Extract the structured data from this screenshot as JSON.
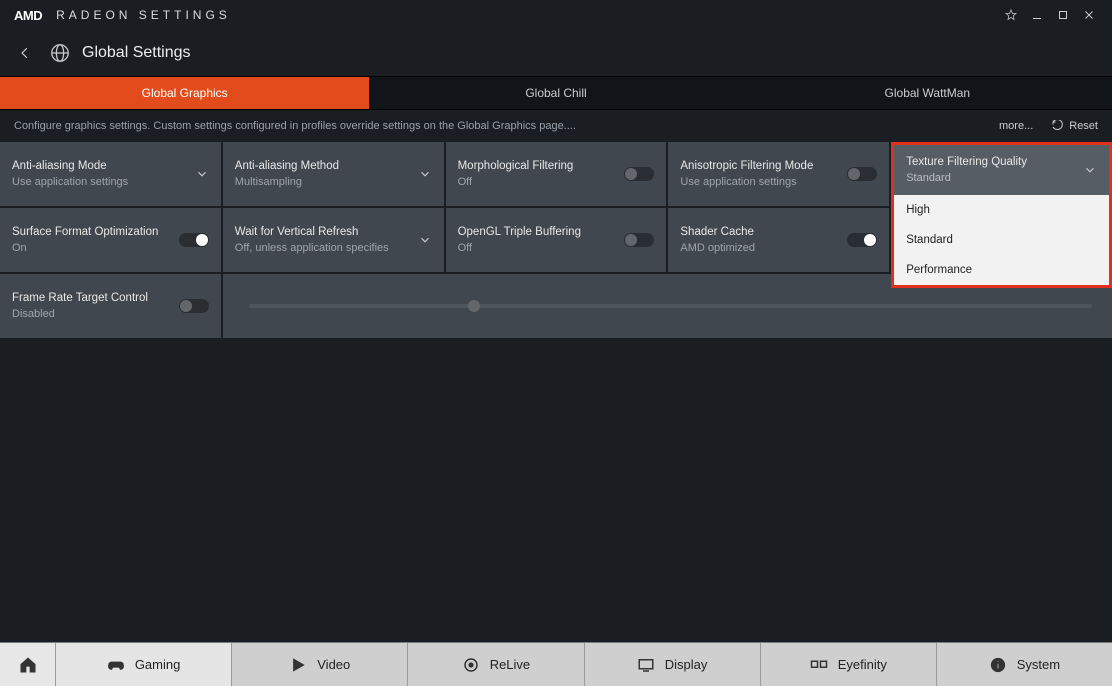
{
  "titlebar": {
    "logo": "AMD",
    "app_name": "RADEON SETTINGS"
  },
  "header": {
    "title": "Global Settings"
  },
  "tabs": [
    {
      "label": "Global Graphics",
      "active": true
    },
    {
      "label": "Global Chill",
      "active": false
    },
    {
      "label": "Global WattMan",
      "active": false
    }
  ],
  "desc": {
    "text": "Configure graphics settings. Custom settings configured in profiles override settings on the Global Graphics page....",
    "more": "more...",
    "reset": "Reset"
  },
  "cards": {
    "aa_mode": {
      "label": "Anti-aliasing Mode",
      "value": "Use application settings",
      "control": "dropdown"
    },
    "aa_method": {
      "label": "Anti-aliasing Method",
      "value": "Multisampling",
      "control": "dropdown"
    },
    "morph_filter": {
      "label": "Morphological Filtering",
      "value": "Off",
      "control": "toggle",
      "on": false
    },
    "aniso_mode": {
      "label": "Anisotropic Filtering Mode",
      "value": "Use application settings",
      "control": "toggle",
      "on": false
    },
    "tex_quality": {
      "label": "Texture Filtering Quality",
      "value": "Standard",
      "control": "dropdown"
    },
    "surface_opt": {
      "label": "Surface Format Optimization",
      "value": "On",
      "control": "toggle",
      "on": true
    },
    "vsync": {
      "label": "Wait for Vertical Refresh",
      "value": "Off, unless application specifies",
      "control": "dropdown"
    },
    "triple_buf": {
      "label": "OpenGL Triple Buffering",
      "value": "Off",
      "control": "toggle",
      "on": false
    },
    "shader_cache": {
      "label": "Shader Cache",
      "value": "AMD optimized",
      "control": "toggle",
      "on": true
    },
    "frtc": {
      "label": "Frame Rate Target Control",
      "value": "Disabled",
      "control": "toggle",
      "on": false
    }
  },
  "tex_quality_options": [
    "High",
    "Standard",
    "Performance"
  ],
  "bottom_nav": [
    {
      "label": "Gaming",
      "icon": "gamepad"
    },
    {
      "label": "Video",
      "icon": "play"
    },
    {
      "label": "ReLive",
      "icon": "record"
    },
    {
      "label": "Display",
      "icon": "monitor"
    },
    {
      "label": "Eyefinity",
      "icon": "multi-monitor"
    },
    {
      "label": "System",
      "icon": "info"
    }
  ]
}
